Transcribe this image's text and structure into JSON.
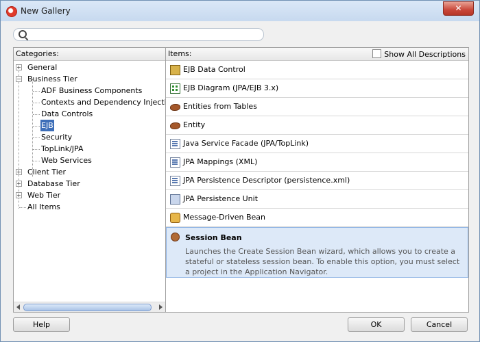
{
  "window": {
    "title": "New Gallery",
    "close_label": "✕"
  },
  "search": {
    "placeholder": ""
  },
  "categories": {
    "header": "Categories:",
    "items": [
      {
        "label": "General",
        "level": 0,
        "expander": "+"
      },
      {
        "label": "Business Tier",
        "level": 0,
        "expander": "−"
      },
      {
        "label": "ADF Business Components",
        "level": 1
      },
      {
        "label": "Contexts and Dependency Injection",
        "level": 1
      },
      {
        "label": "Data Controls",
        "level": 1
      },
      {
        "label": "EJB",
        "level": 1,
        "selected": true
      },
      {
        "label": "Security",
        "level": 1
      },
      {
        "label": "TopLink/JPA",
        "level": 1
      },
      {
        "label": "Web Services",
        "level": 1
      },
      {
        "label": "Client Tier",
        "level": 0,
        "expander": "+"
      },
      {
        "label": "Database Tier",
        "level": 0,
        "expander": "+"
      },
      {
        "label": "Web Tier",
        "level": 0,
        "expander": "+"
      },
      {
        "label": "All Items",
        "level": 0
      }
    ]
  },
  "items_panel": {
    "header": "Items:",
    "show_all_label": "Show All Descriptions",
    "items": [
      {
        "label": "EJB Data Control",
        "icon": "data-control-icon"
      },
      {
        "label": "EJB Diagram (JPA/EJB 3.x)",
        "icon": "diagram-icon"
      },
      {
        "label": "Entities from Tables",
        "icon": "bean-icon"
      },
      {
        "label": "Entity",
        "icon": "bean-icon"
      },
      {
        "label": "Java Service Facade (JPA/TopLink)",
        "icon": "service-facade-icon"
      },
      {
        "label": "JPA Mappings (XML)",
        "icon": "xml-mapping-icon"
      },
      {
        "label": "JPA Persistence Descriptor (persistence.xml)",
        "icon": "descriptor-icon"
      },
      {
        "label": "JPA Persistence Unit",
        "icon": "persistence-unit-icon"
      },
      {
        "label": "Message-Driven Bean",
        "icon": "message-bean-icon"
      }
    ],
    "selected": {
      "label": "Session Bean",
      "icon": "session-bean-icon",
      "description": "Launches the Create Session Bean wizard, which allows you to create a stateful or stateless session bean. To enable this option, you must select a project in the Application Navigator."
    }
  },
  "buttons": {
    "help": "Help",
    "ok": "OK",
    "cancel": "Cancel"
  }
}
